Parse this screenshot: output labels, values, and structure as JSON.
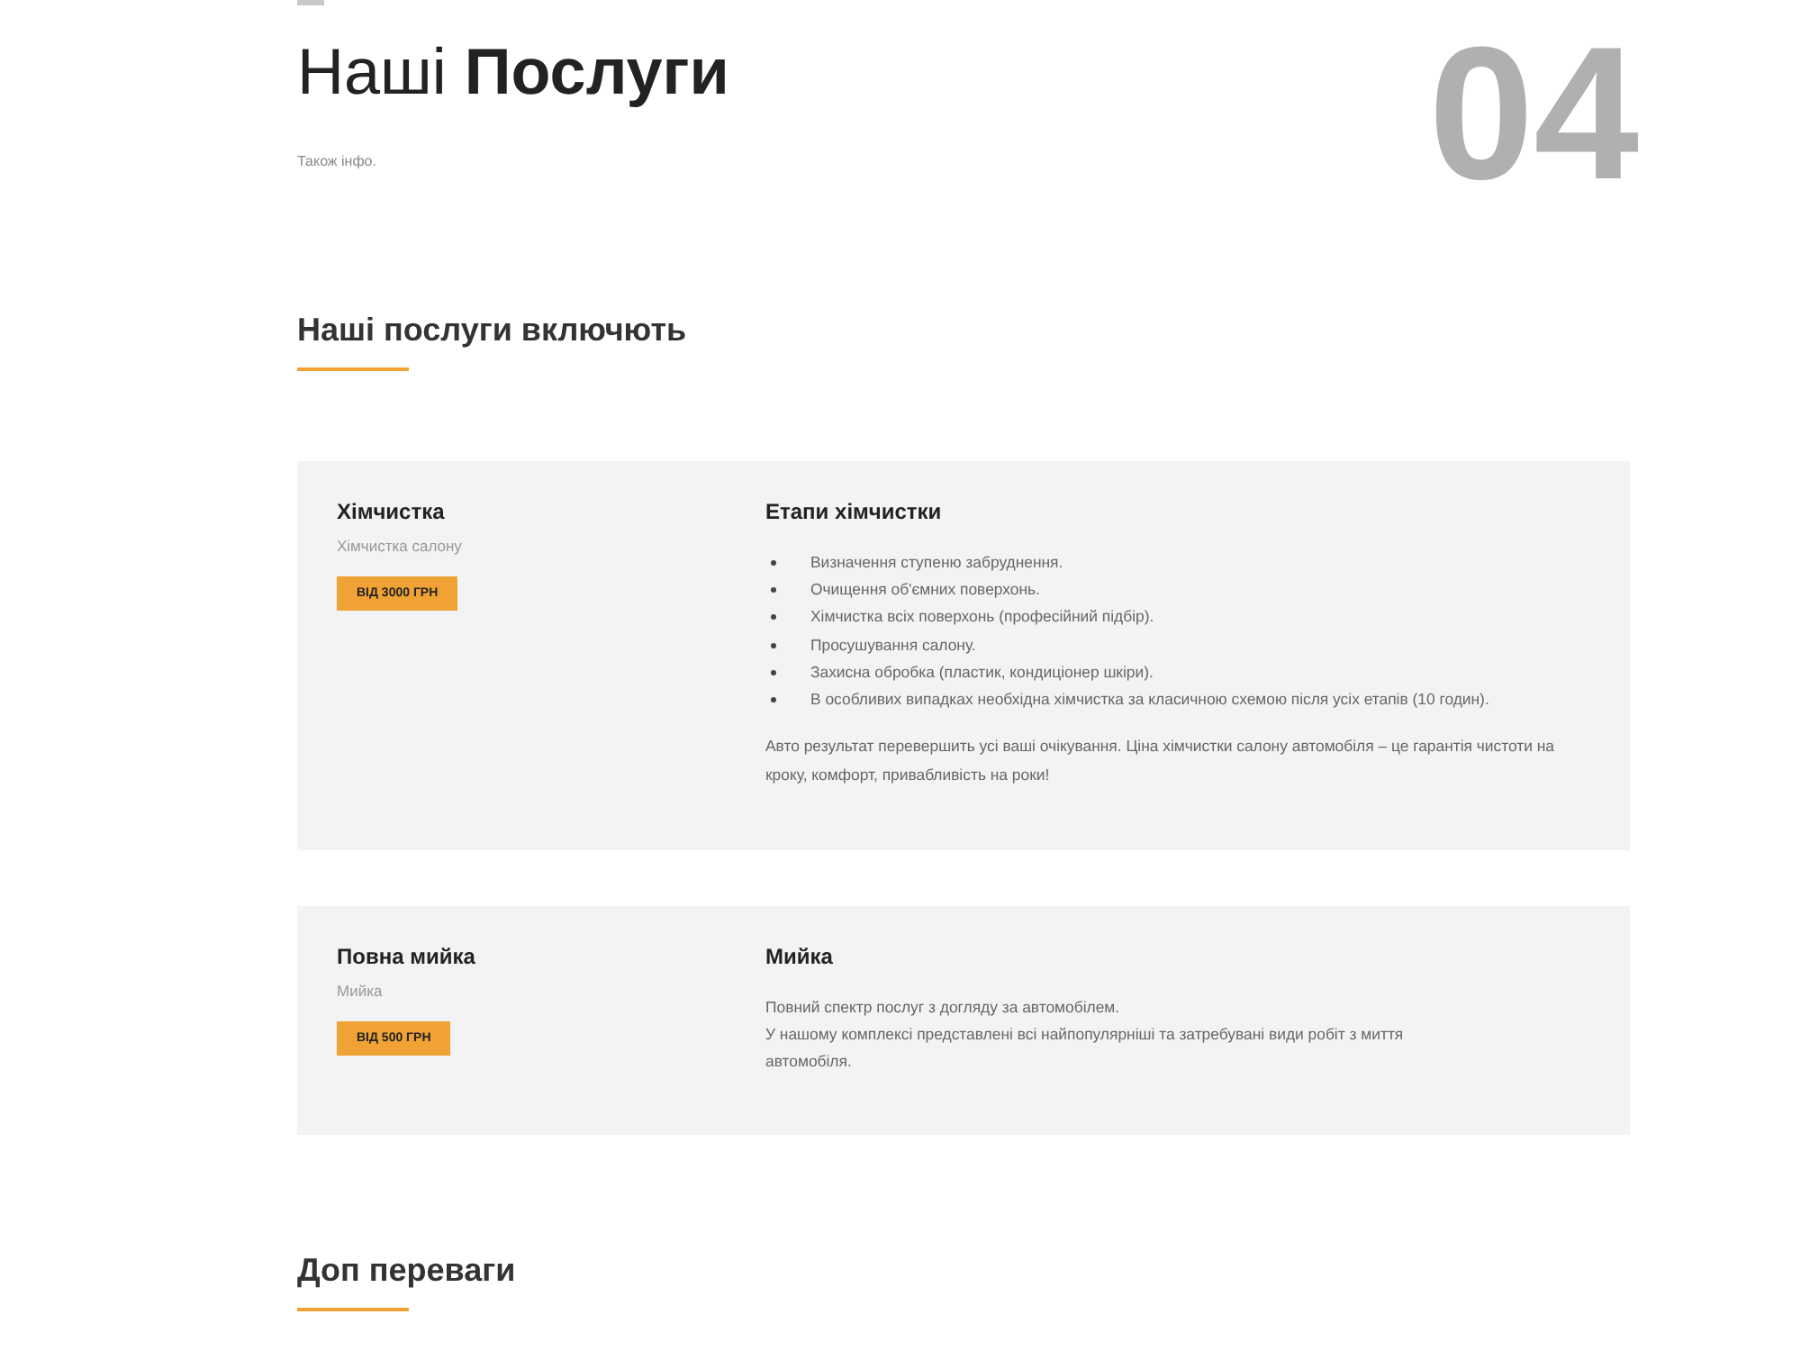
{
  "header": {
    "title": "Наші **Послуги**",
    "subtitle": "Також інфо.",
    "number": "04"
  },
  "services_section": {
    "heading": "Наші послуги включють",
    "cards": [
      {
        "title": "Хімчистка",
        "subtitle": "Хімчистка салону",
        "price_button": "ВІД 3000 ГРН",
        "details_title": "Етапи хімчистки",
        "steps": [
          "Визначення ступеню забруднення.",
          "Очищення об'ємних поверхонь.",
          "Хімчистка всіх поверхонь (професійний підбір).",
          "Просушування салону.",
          "Захисна обробка (пластик, кондиціонер шкіри).",
          "В особливих випадках необхідна хімчистка за класичною схемою після усіх етапів (10 годин)."
        ],
        "paragraphs": [
          "Авто результат перевершить усі ваші очікування. Ціна хімчистки салону автомобіля – це гарантія чистоти на кроку, комфорт, привабливість на роки!"
        ]
      },
      {
        "title": "Повна мийка",
        "subtitle": "Мийка",
        "price_button": "ВІД 500 ГРН",
        "details_title": "Мийка",
        "paragraphs": [
          "Повний спектр послуг з догляду за автомобілем.",
          "У нашому комплексі представлені всі найпопулярніші та затребувані види робіт з миття автомобіля."
        ]
      }
    ]
  },
  "extras_section": {
    "heading": "Доп переваги"
  }
}
